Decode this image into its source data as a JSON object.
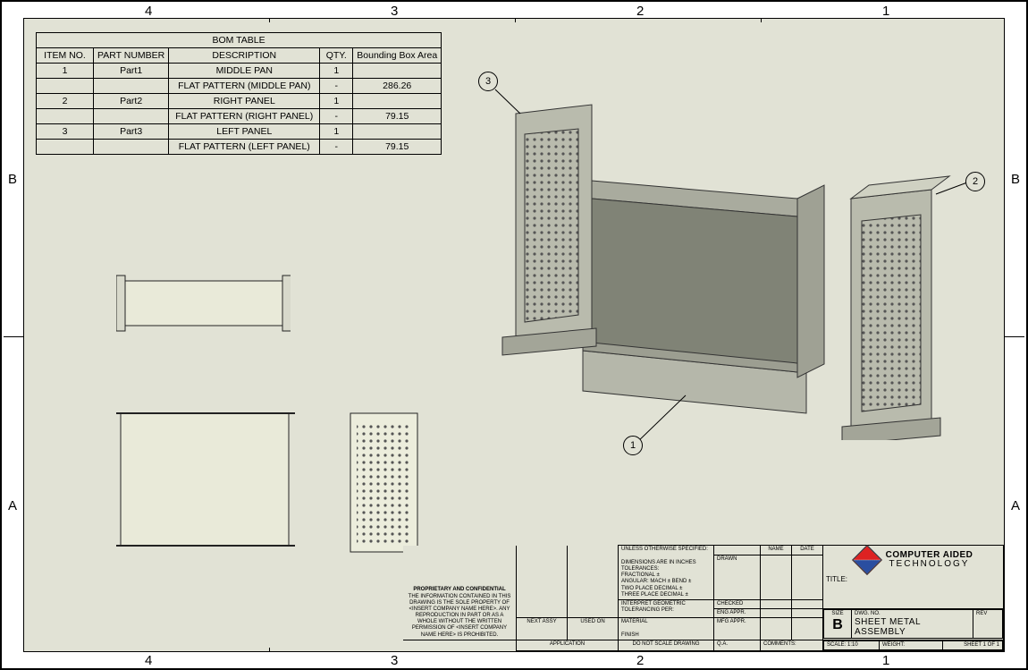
{
  "zones": {
    "cols": [
      "4",
      "3",
      "2",
      "1"
    ],
    "rows": [
      "B",
      "A"
    ]
  },
  "bom": {
    "title": "BOM TABLE",
    "headers": [
      "ITEM NO.",
      "PART NUMBER",
      "DESCRIPTION",
      "QTY.",
      "Bounding Box Area"
    ],
    "rows": [
      [
        "1",
        "Part1",
        "MIDDLE PAN",
        "1",
        ""
      ],
      [
        "",
        "",
        "FLAT PATTERN (MIDDLE PAN)",
        "-",
        "286.26"
      ],
      [
        "2",
        "Part2",
        "RIGHT PANEL",
        "1",
        ""
      ],
      [
        "",
        "",
        "FLAT PATTERN (RIGHT PANEL)",
        "-",
        "79.15"
      ],
      [
        "3",
        "Part3",
        "LEFT PANEL",
        "1",
        ""
      ],
      [
        "",
        "",
        "FLAT PATTERN (LEFT PANEL)",
        "-",
        "79.15"
      ]
    ]
  },
  "balloons": {
    "b1": "1",
    "b2": "2",
    "b3": "3"
  },
  "titleblock": {
    "prop_header": "PROPRIETARY AND CONFIDENTIAL",
    "prop_body": "THE INFORMATION CONTAINED IN THIS DRAWING IS THE SOLE PROPERTY OF <INSERT COMPANY NAME HERE>. ANY REPRODUCTION IN PART OR AS A WHOLE WITHOUT THE WRITTEN PERMISSION OF <INSERT COMPANY NAME HERE> IS PROHIBITED.",
    "next_assy": "NEXT ASSY",
    "used_on": "USED ON",
    "application": "APPLICATION",
    "unless": "UNLESS OTHERWISE SPECIFIED:",
    "tol1": "DIMENSIONS ARE IN INCHES",
    "tol2": "TOLERANCES:",
    "tol3": "FRACTIONAL ±",
    "tol4": "ANGULAR: MACH ±   BEND ±",
    "tol5": "TWO PLACE DECIMAL    ±",
    "tol6": "THREE PLACE DECIMAL  ±",
    "tol7": "INTERPRET GEOMETRIC",
    "tol8": "TOLERANCING PER:",
    "material": "MATERIAL",
    "finish": "FINISH",
    "dnsd": "DO NOT SCALE DRAWING",
    "name": "NAME",
    "date": "DATE",
    "drawn": "DRAWN",
    "checked": "CHECKED",
    "engappr": "ENG APPR.",
    "mfgappr": "MFG APPR.",
    "qa": "Q.A.",
    "comments": "COMMENTS:",
    "title_lbl": "TITLE:",
    "size_lbl": "SIZE",
    "size_val": "B",
    "dwgno_lbl": "DWG.  NO.",
    "dwgno_val": "SHEET METAL ASSEMBLY",
    "rev_lbl": "REV",
    "scale_lbl": "SCALE: 1:10",
    "weight_lbl": "WEIGHT:",
    "sheet_lbl": "SHEET 1 OF 1",
    "logo_l1": "COMPUTER AIDED",
    "logo_l2": "TECHNOLOGY"
  }
}
